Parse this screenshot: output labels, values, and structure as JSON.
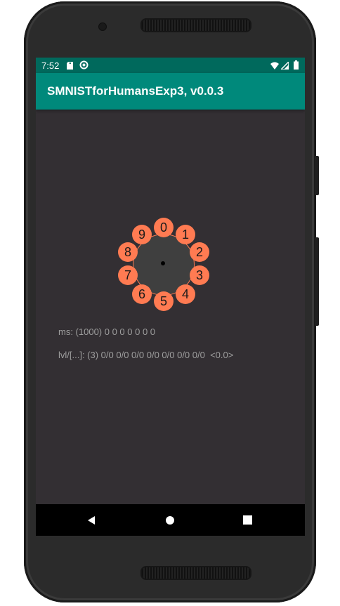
{
  "status_bar": {
    "time": "7:52",
    "icons": [
      "sd-card-icon",
      "sync-icon",
      "wifi-icon",
      "signal-icon",
      "battery-icon"
    ]
  },
  "app_bar": {
    "title": "SMNISTforHumansExp3, v0.0.3"
  },
  "dial": {
    "digits": [
      "0",
      "1",
      "2",
      "3",
      "4",
      "5",
      "6",
      "7",
      "8",
      "9"
    ],
    "colors": {
      "digit": "#ff7b52",
      "center": "#3f3f3f"
    }
  },
  "info": {
    "ms_line": "ms: (1000) 0 0 0 0 0 0 0",
    "lvl_line": "lvl/[...]: (3) 0/0 0/0 0/0 0/0 0/0 0/0 0/0  <0.0>"
  },
  "nav_bar": {
    "icons": [
      "back-icon",
      "home-icon",
      "recents-icon"
    ]
  },
  "colors": {
    "status_bar": "#00695c",
    "app_bar": "#00897b",
    "background": "#332f33"
  }
}
